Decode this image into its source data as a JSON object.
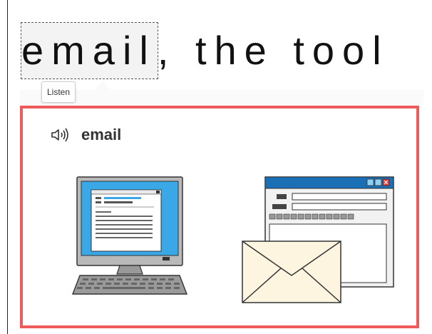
{
  "headline": {
    "selected_word": "email",
    "rest": ", the tool"
  },
  "tooltip": {
    "label": "Listen"
  },
  "card": {
    "word": "email"
  },
  "colors": {
    "card_border": "#ef5b5b",
    "screen_blue": "#3aa7e6",
    "envelope": "#fdf5e0"
  },
  "icons": [
    "speaker-icon",
    "computer-illustration",
    "email-window-illustration",
    "envelope-illustration"
  ]
}
